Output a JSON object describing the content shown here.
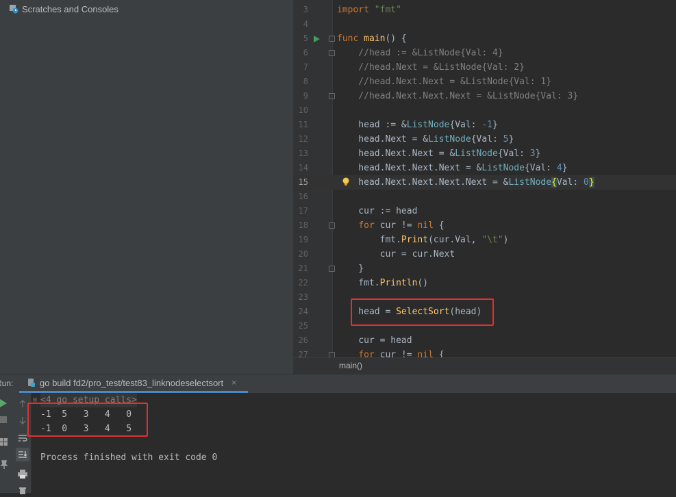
{
  "project": {
    "item_label": "Scratches and Consoles"
  },
  "editor": {
    "lines": [
      {
        "n": "3",
        "parts": [
          {
            "t": "import ",
            "c": "kw"
          },
          {
            "t": "\"fmt\"",
            "c": "str"
          }
        ]
      },
      {
        "n": "4",
        "parts": []
      },
      {
        "n": "5",
        "run": true,
        "fold": true,
        "parts": [
          {
            "t": "func ",
            "c": "kw"
          },
          {
            "t": "main",
            "c": "fn"
          },
          {
            "t": "() {",
            "c": ""
          }
        ]
      },
      {
        "n": "6",
        "fold": true,
        "parts": [
          {
            "t": "    //head := &ListNode{Val: 4}",
            "c": "cmt"
          }
        ]
      },
      {
        "n": "7",
        "parts": [
          {
            "t": "    //head.Next = &ListNode{Val: 2}",
            "c": "cmt"
          }
        ]
      },
      {
        "n": "8",
        "parts": [
          {
            "t": "    //head.Next.Next = &ListNode{Val: 1}",
            "c": "cmt"
          }
        ]
      },
      {
        "n": "9",
        "fold": true,
        "parts": [
          {
            "t": "    //head.Next.Next.Next = &ListNode{Val: 3}",
            "c": "cmt"
          }
        ]
      },
      {
        "n": "10",
        "parts": []
      },
      {
        "n": "11",
        "parts": [
          {
            "t": "    head := &",
            "c": ""
          },
          {
            "t": "ListNode",
            "c": "typ"
          },
          {
            "t": "{Val: ",
            "c": ""
          },
          {
            "t": "-1",
            "c": "num"
          },
          {
            "t": "}",
            "c": ""
          }
        ]
      },
      {
        "n": "12",
        "parts": [
          {
            "t": "    head.Next = &",
            "c": ""
          },
          {
            "t": "ListNode",
            "c": "typ"
          },
          {
            "t": "{Val: ",
            "c": ""
          },
          {
            "t": "5",
            "c": "num"
          },
          {
            "t": "}",
            "c": ""
          }
        ]
      },
      {
        "n": "13",
        "parts": [
          {
            "t": "    head.Next.Next = &",
            "c": ""
          },
          {
            "t": "ListNode",
            "c": "typ"
          },
          {
            "t": "{Val: ",
            "c": ""
          },
          {
            "t": "3",
            "c": "num"
          },
          {
            "t": "}",
            "c": ""
          }
        ]
      },
      {
        "n": "14",
        "parts": [
          {
            "t": "    head.Next.Next.Next = &",
            "c": ""
          },
          {
            "t": "ListNode",
            "c": "typ"
          },
          {
            "t": "{Val: ",
            "c": ""
          },
          {
            "t": "4",
            "c": "num"
          },
          {
            "t": "}",
            "c": ""
          }
        ]
      },
      {
        "n": "15",
        "current": true,
        "bulb": true,
        "parts": [
          {
            "t": "    head.Next.Next.Next.Next = &",
            "c": ""
          },
          {
            "t": "ListNode",
            "c": "typ"
          },
          {
            "t": "{",
            "c": "br"
          },
          {
            "t": "Val: ",
            "c": ""
          },
          {
            "t": "0",
            "c": "num"
          },
          {
            "t": "}",
            "c": "br"
          }
        ]
      },
      {
        "n": "16",
        "parts": []
      },
      {
        "n": "17",
        "parts": [
          {
            "t": "    cur := head",
            "c": ""
          }
        ]
      },
      {
        "n": "18",
        "fold": true,
        "parts": [
          {
            "t": "    ",
            "c": ""
          },
          {
            "t": "for ",
            "c": "kw"
          },
          {
            "t": "cur != ",
            "c": ""
          },
          {
            "t": "nil",
            "c": "kw"
          },
          {
            "t": " {",
            "c": ""
          }
        ]
      },
      {
        "n": "19",
        "parts": [
          {
            "t": "        fmt.",
            "c": ""
          },
          {
            "t": "Print",
            "c": "fn"
          },
          {
            "t": "(cur.Val, ",
            "c": ""
          },
          {
            "t": "\"\\t\"",
            "c": "str"
          },
          {
            "t": ")",
            "c": ""
          }
        ]
      },
      {
        "n": "20",
        "parts": [
          {
            "t": "        cur = cur.Next",
            "c": ""
          }
        ]
      },
      {
        "n": "21",
        "fold": true,
        "parts": [
          {
            "t": "    }",
            "c": ""
          }
        ]
      },
      {
        "n": "22",
        "parts": [
          {
            "t": "    fmt.",
            "c": ""
          },
          {
            "t": "Println",
            "c": "fn"
          },
          {
            "t": "()",
            "c": ""
          }
        ]
      },
      {
        "n": "23",
        "parts": []
      },
      {
        "n": "24",
        "parts": [
          {
            "t": "    head = ",
            "c": ""
          },
          {
            "t": "SelectSort",
            "c": "fn"
          },
          {
            "t": "(head)",
            "c": ""
          }
        ]
      },
      {
        "n": "25",
        "parts": []
      },
      {
        "n": "26",
        "parts": [
          {
            "t": "    cur = head",
            "c": ""
          }
        ]
      },
      {
        "n": "27",
        "fold": true,
        "parts": [
          {
            "t": "    ",
            "c": ""
          },
          {
            "t": "for ",
            "c": "kw"
          },
          {
            "t": "cur != ",
            "c": ""
          },
          {
            "t": "nil",
            "c": "kw"
          },
          {
            "t": " {",
            "c": ""
          }
        ]
      }
    ],
    "breadcrumb": "main()"
  },
  "run": {
    "label": "Run:",
    "tab_title": "go build fd2/pro_test/test83_linknodeselectsort",
    "tab_close": "×"
  },
  "console": {
    "setup_calls": "<4 go setup calls>",
    "output_line_1": "-1  5   3   4   0",
    "output_line_2": "-1  0   3   4   5",
    "finish_message": "Process finished with exit code 0"
  }
}
